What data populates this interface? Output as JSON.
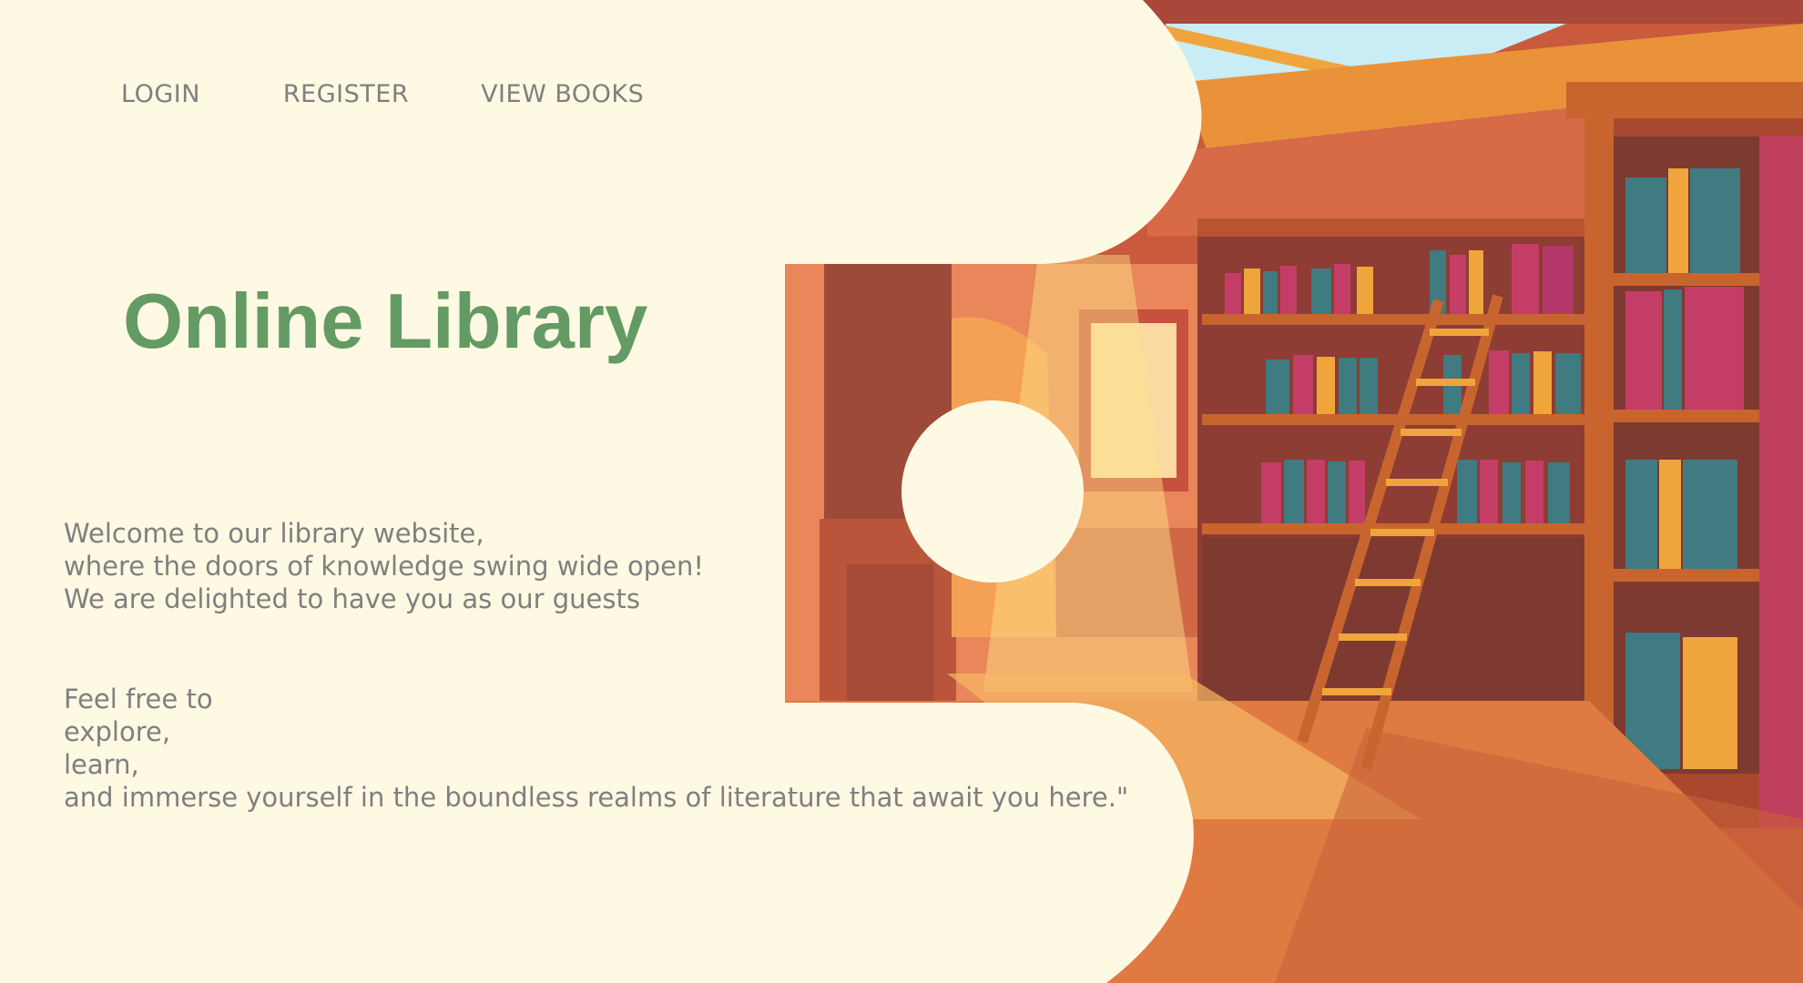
{
  "nav": {
    "login": "LOGIN",
    "register": "REGISTER",
    "view_books": "VIEW BOOKS"
  },
  "hero": {
    "title": "Online Library",
    "intro_lines": [
      "Welcome to our library website,",
      "where the doors of knowledge swing wide open!",
      "We are delighted to have you as our guests"
    ],
    "explore_lines": [
      "Feel free to",
      "explore,",
      "learn,",
      "and immerse yourself in the boundless realms of literature that await you here.\""
    ]
  },
  "colors": {
    "background": "#fdf9e3",
    "title": "#649a64",
    "text": "#7f7f7f",
    "wall": "#c2573e",
    "shelf": "#b8552f",
    "floor": "#e07a43",
    "sky": "#c9ecf5",
    "book_teal": "#3f7b80",
    "book_pink": "#c43d66",
    "book_gold": "#f0a53c"
  },
  "illustration": {
    "name": "library-interior-illustration"
  }
}
